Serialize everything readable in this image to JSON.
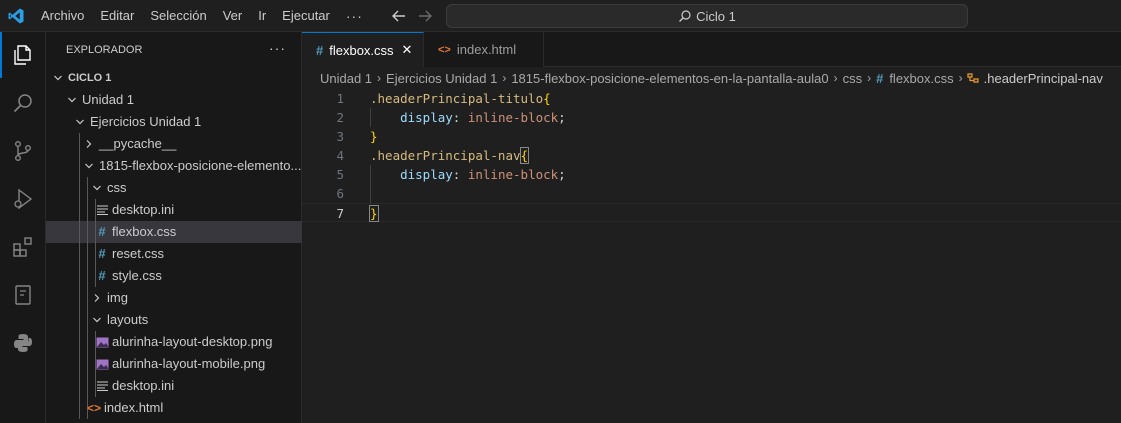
{
  "menu": {
    "items": [
      "Archivo",
      "Editar",
      "Selección",
      "Ver",
      "Ir",
      "Ejecutar"
    ],
    "more": "···"
  },
  "command_center": {
    "label": "Ciclo 1"
  },
  "explorer": {
    "title": "EXPLORADOR",
    "more": "···",
    "tree": [
      {
        "label": "CICLO 1",
        "level": 0,
        "type": "folder-open",
        "bold": true
      },
      {
        "label": "Unidad 1",
        "level": 1,
        "type": "folder-open"
      },
      {
        "label": "Ejercicios Unidad 1",
        "level": 2,
        "type": "folder-open"
      },
      {
        "label": "__pycache__",
        "level": 3,
        "type": "folder-closed"
      },
      {
        "label": "1815-flexbox-posicione-elemento...",
        "level": 3,
        "type": "folder-open"
      },
      {
        "label": "css",
        "level": 4,
        "type": "folder-open"
      },
      {
        "label": "desktop.ini",
        "level": 5,
        "type": "ini"
      },
      {
        "label": "flexbox.css",
        "level": 5,
        "type": "css",
        "selected": true
      },
      {
        "label": "reset.css",
        "level": 5,
        "type": "css"
      },
      {
        "label": "style.css",
        "level": 5,
        "type": "css"
      },
      {
        "label": "img",
        "level": 4,
        "type": "folder-closed"
      },
      {
        "label": "layouts",
        "level": 4,
        "type": "folder-open"
      },
      {
        "label": "alurinha-layout-desktop.png",
        "level": 5,
        "type": "png"
      },
      {
        "label": "alurinha-layout-mobile.png",
        "level": 5,
        "type": "png"
      },
      {
        "label": "desktop.ini",
        "level": 5,
        "type": "ini"
      },
      {
        "label": "index.html",
        "level": 4,
        "type": "html"
      }
    ]
  },
  "tabs": [
    {
      "label": "flexbox.css",
      "icon": "#",
      "active": true,
      "close": "✕"
    },
    {
      "label": "index.html",
      "icon": "<>",
      "active": false
    }
  ],
  "breadcrumb": [
    "Unidad 1",
    "Ejercicios Unidad 1",
    "1815-flexbox-posicione-elementos-en-la-pantalla-aula0",
    "css",
    "flexbox.css",
    ".headerPrincipal-nav"
  ],
  "breadcrumb_icons": {
    "file": "#"
  },
  "code": {
    "line_numbers": [
      "1",
      "2",
      "3",
      "4",
      "5",
      "6",
      "7"
    ],
    "current_line": 7,
    "lines": [
      [
        {
          "t": ".headerPrincipal-titulo",
          "c": "sel"
        },
        {
          "t": "{",
          "c": "brace"
        }
      ],
      [
        {
          "t": "    ",
          "c": "punc"
        },
        {
          "t": "display",
          "c": "prop"
        },
        {
          "t": ": ",
          "c": "punc"
        },
        {
          "t": "inline-block",
          "c": "val"
        },
        {
          "t": ";",
          "c": "punc"
        }
      ],
      [
        {
          "t": "}",
          "c": "brace"
        }
      ],
      [
        {
          "t": ".headerPrincipal-nav",
          "c": "sel"
        },
        {
          "t": "{",
          "c": "brace"
        }
      ],
      [
        {
          "t": "    ",
          "c": "punc"
        },
        {
          "t": "display",
          "c": "prop"
        },
        {
          "t": ": ",
          "c": "punc"
        },
        {
          "t": "inline-block",
          "c": "val"
        },
        {
          "t": ";",
          "c": "punc"
        }
      ],
      [],
      [
        {
          "t": "}",
          "c": "brace"
        }
      ]
    ]
  },
  "colors": {
    "accent": "#0078d4",
    "css_icon": "#519aba",
    "html_icon": "#e37933",
    "selector": "#d7ba7d",
    "property": "#9cdcfe",
    "value": "#ce9178",
    "bracket": "#ffd700"
  }
}
